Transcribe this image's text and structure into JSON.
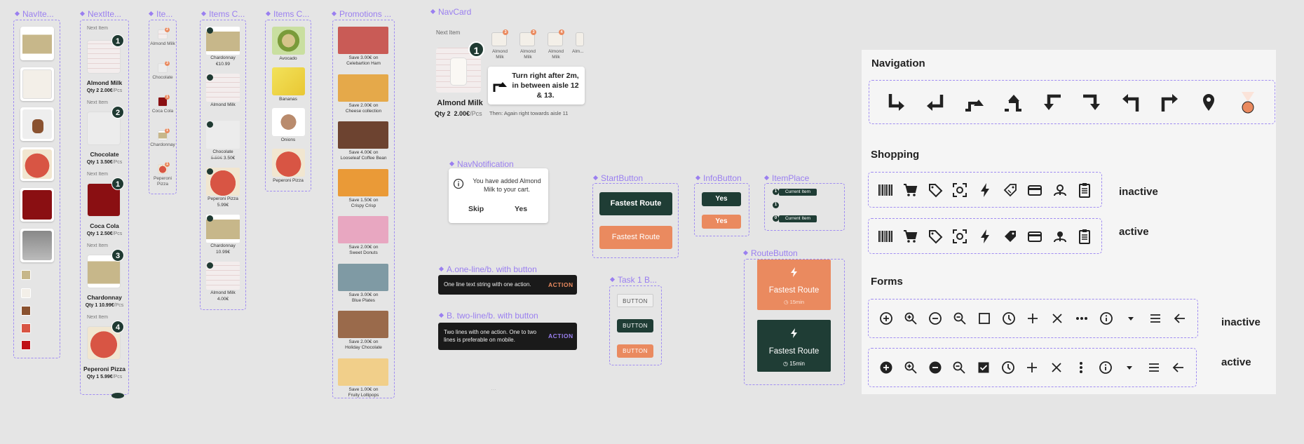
{
  "colors": {
    "dark_green": "#1f3d35",
    "orange": "#ea8a5f",
    "purple": "#9a7ff0"
  },
  "frames": {
    "navitem": "NavIte...",
    "nextitem": "NextIte...",
    "ite": "Ite...",
    "itemsc1": "Items C...",
    "itemsc2": "Items C...",
    "promotions": "Promotions ...",
    "navcard": "NavCard",
    "navnotification": "NavNotification",
    "startbutton": "StartButton",
    "infobutton": "InfoButton",
    "itemplace": "ItemPlace",
    "oneline": "A.one-line/b. with button",
    "twoline": "B. two-line/b. with button",
    "task": "Task 1 B...",
    "routebutton": "RouteButton"
  },
  "nextitem": {
    "header": "Next Item",
    "items": [
      {
        "badge": "1",
        "name": "Almond Milk",
        "qty": "Qty 2",
        "price": "2.00€",
        "unit": "/Pcs"
      },
      {
        "badge": "2",
        "name": "Chocolate",
        "qty": "Qty 1",
        "price": "3.50€",
        "unit": "/Pcs"
      },
      {
        "badge": "1",
        "name": "Coca Cola",
        "qty": "Qty 1",
        "price": "2.50€",
        "unit": "/Pcs"
      },
      {
        "badge": "3",
        "name": "Chardonnay",
        "qty": "Qty 1",
        "price": "10.99€",
        "unit": "/Pcs"
      },
      {
        "badge": "4",
        "name": "Peperoni Pizza",
        "qty": "Qty 1",
        "price": "5.99€",
        "unit": "/Pcs"
      }
    ]
  },
  "ite": {
    "items": [
      {
        "badge": "2",
        "name": "Almond Milk"
      },
      {
        "badge": "3",
        "name": "Chocolate"
      },
      {
        "badge": "1",
        "name": "Coca Cola"
      },
      {
        "badge": "1",
        "name": "Chardonnay"
      },
      {
        "badge": "1",
        "name": "Peperoni Pizza"
      }
    ]
  },
  "itemsc1": {
    "items": [
      {
        "label": "Chardonnay",
        "price": "€10.99",
        "old": ""
      },
      {
        "label": "Almond Milk",
        "price": "",
        "old": ""
      },
      {
        "label": "Chocolate",
        "price": "3.50€",
        "old": "5.50€"
      },
      {
        "label": "Peperoni Pizza",
        "price": "5.99€",
        "old": ""
      },
      {
        "label": "Chardonnay",
        "price": "10.99€",
        "old": ""
      },
      {
        "label": "Almond Milk",
        "price": "4.00€",
        "old": ""
      }
    ]
  },
  "itemsc2": {
    "items": [
      {
        "label": "Avocado"
      },
      {
        "label": "Bananas"
      },
      {
        "label": "Onions"
      },
      {
        "label": "Peperoni Pizza"
      }
    ]
  },
  "promotions": {
    "items": [
      {
        "line1": "Save 3.00€ on",
        "line2": "Celebartion Ham"
      },
      {
        "line1": "Save 2.00€ on",
        "line2": "Cheese collection"
      },
      {
        "line1": "Save 4.00€ on",
        "line2": "Looseleaf Coffee Bean"
      },
      {
        "line1": "Save 1.50€ on",
        "line2": "Crispy Crisp"
      },
      {
        "line1": "Save 2.00€ on",
        "line2": "Sweet Donuts"
      },
      {
        "line1": "Save 3.00€ on",
        "line2": "Blue Plates"
      },
      {
        "line1": "Save 2.00€ on",
        "line2": "Holiday Chocolate"
      },
      {
        "line1": "Save 1.00€ on",
        "line2": "Fruity Lollipops"
      }
    ]
  },
  "navcard": {
    "header": "Next Item",
    "badge": "1",
    "name": "Almond Milk",
    "qty": "Qty 2",
    "price": "2.00€",
    "unit": "/Pcs",
    "instruction": "Turn right after 2m, in between aisle 12 & 13.",
    "then": "Then: Again right towards aisle 11",
    "upcoming": [
      {
        "badge": "3",
        "label": "Almond Milk"
      },
      {
        "badge": "3",
        "label": "Almond Milk"
      },
      {
        "badge": "4",
        "label": "Almond Milk"
      },
      {
        "badge": "",
        "label": "Alm..."
      }
    ]
  },
  "navnotification": {
    "message": "You have added Almond Milk to your cart.",
    "skip": "Skip",
    "yes": "Yes"
  },
  "startbutton": {
    "label1": "Fastest Route",
    "label2": "Fastest Route"
  },
  "infobutton": {
    "label1": "Yes",
    "label2": "Yes"
  },
  "itemplace": {
    "rows": [
      {
        "n": "1",
        "label": "Current Item"
      },
      {
        "n": "1",
        "label": ""
      },
      {
        "n": "0",
        "label": "Current Item"
      }
    ]
  },
  "snackbars": {
    "one_text": "One line text string with one action.",
    "one_action": "ACTION",
    "two_text": "Two lines with one action. One to two lines is preferable on mobile.",
    "two_action": "ACTION"
  },
  "task": {
    "b1": "BUTTON",
    "b2": "BUTTON",
    "b3": "BUTTON"
  },
  "routebutton": {
    "label1": "Fastest Route",
    "time1": "15min",
    "label2": "Fastest Route",
    "time2": "15min"
  },
  "panel": {
    "navigation": "Navigation",
    "shopping": "Shopping",
    "forms": "Forms",
    "inactive": "inactive",
    "active": "active"
  }
}
